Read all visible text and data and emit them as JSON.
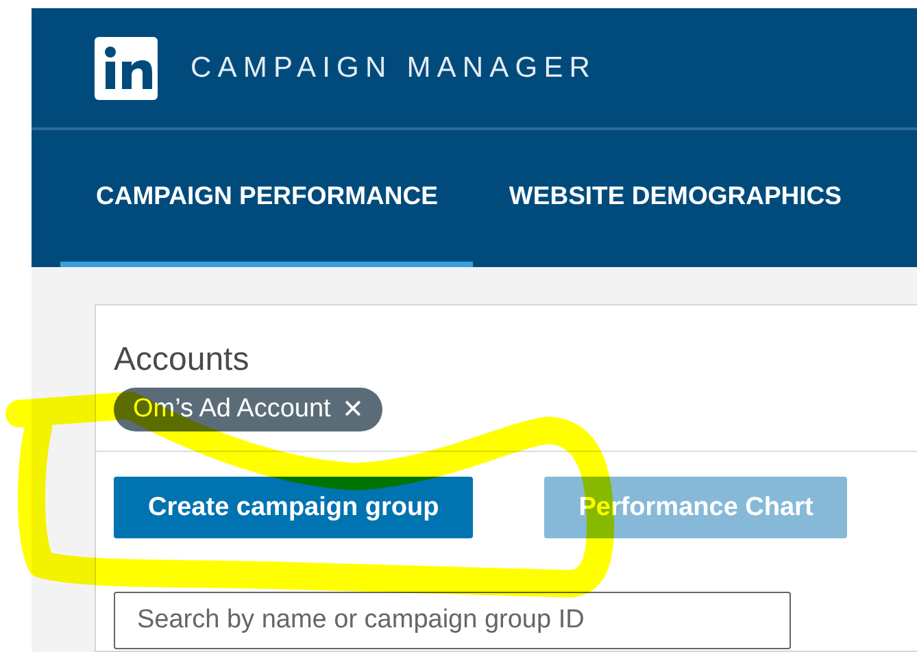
{
  "header": {
    "title": "CAMPAIGN MANAGER"
  },
  "tabs": [
    {
      "label": "CAMPAIGN PERFORMANCE",
      "selected": true
    },
    {
      "label": "WEBSITE DEMOGRAPHICS",
      "selected": false
    }
  ],
  "accounts": {
    "label": "Accounts",
    "chips": [
      {
        "label": "Om’s Ad Account",
        "remove": "✕"
      }
    ]
  },
  "buttons": [
    {
      "label": "Create campaign group",
      "disabled": false
    },
    {
      "label": "Performance Chart",
      "disabled": true
    }
  ],
  "search": {
    "placeholder": "Search by name or campaign group ID"
  },
  "annotation": {
    "kind": "highlighter"
  }
}
